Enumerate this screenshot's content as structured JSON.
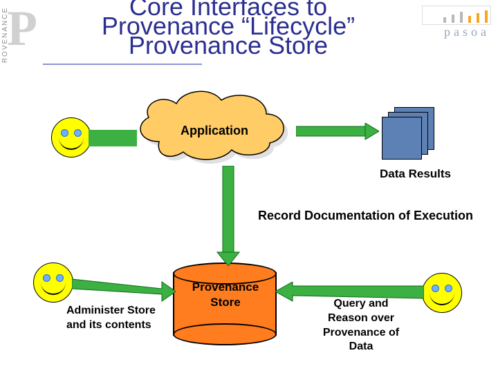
{
  "brand": {
    "sidebar_word": "ROVENANCE",
    "top_word": "pasoa"
  },
  "headline": {
    "line1": "Core Interfaces to",
    "line2": "Provenance “Lifecycle”",
    "line3": "Provenance Store"
  },
  "cloud": {
    "label": "Application"
  },
  "data_results": {
    "label": "Data Results"
  },
  "record": {
    "label": "Record Documentation of Execution"
  },
  "store": {
    "label_top": "Provenance",
    "label_bot": "Store"
  },
  "admin": {
    "label": "Administer Store and its contents"
  },
  "query": {
    "label": "Query and Reason over Provenance of Data"
  }
}
